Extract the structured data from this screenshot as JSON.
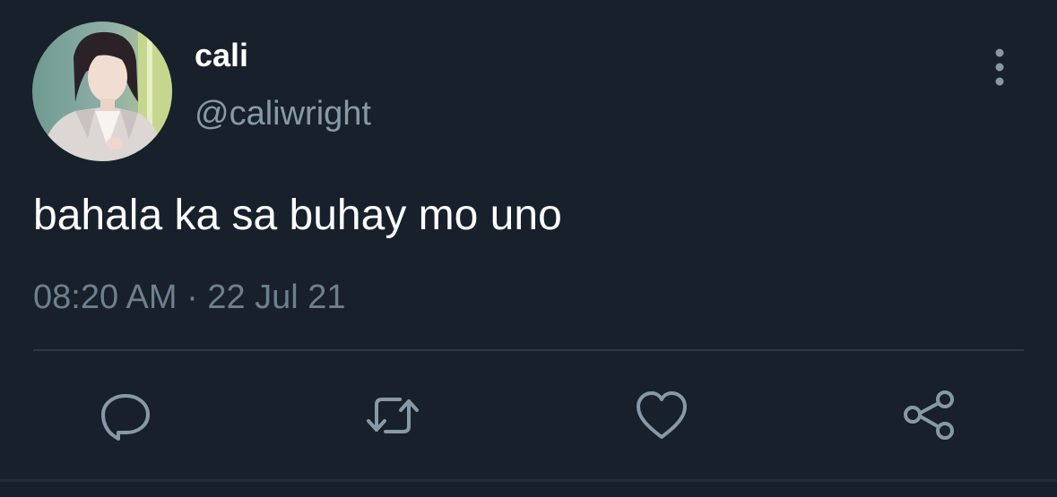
{
  "tweet": {
    "display_name": "cali",
    "handle": "@caliwright",
    "text": "bahala ka sa buhay mo uno",
    "timestamp": "08:20 AM · 22 Jul 21"
  },
  "icons": {
    "more": "more-vertical-icon",
    "reply": "reply-icon",
    "retweet": "retweet-icon",
    "like": "heart-icon",
    "share": "share-icon"
  },
  "colors": {
    "background": "#17202b",
    "text_primary": "#ffffff",
    "text_secondary": "#8899a6",
    "icon": "#8899a6",
    "divider": "#2d3844"
  }
}
